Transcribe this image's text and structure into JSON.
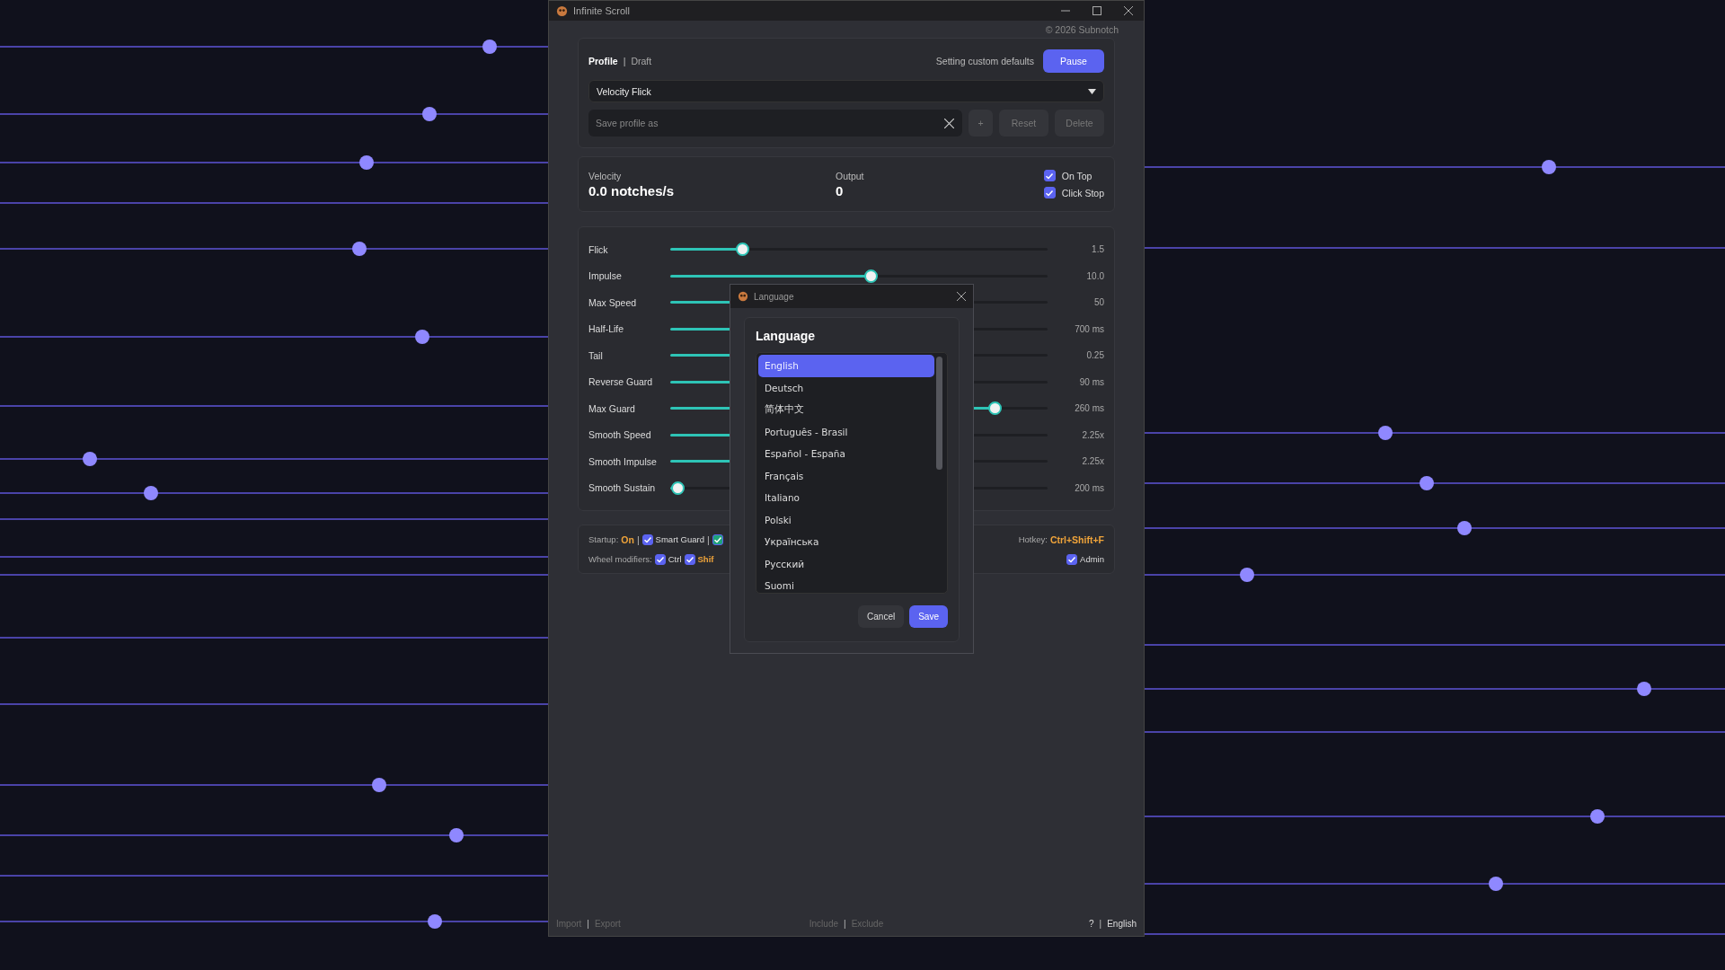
{
  "window": {
    "title": "Infinite Scroll"
  },
  "copyright": "© 2026 Subnotch",
  "profile": {
    "tabs": [
      {
        "label": "Profile",
        "selected": true
      },
      {
        "label": "Draft",
        "selected": false
      }
    ],
    "separator": "|",
    "status": "Setting custom defaults",
    "pause_button": "Pause",
    "dropdown": {
      "value": "Velocity Flick"
    },
    "save_field": {
      "placeholder": "Save profile as"
    },
    "buttons": [
      {
        "label": "+",
        "disabled": true
      },
      {
        "label": "Reset",
        "disabled": true
      },
      {
        "label": "Delete",
        "disabled": true
      }
    ]
  },
  "stats": {
    "readouts": [
      {
        "label": "Velocity",
        "value": "0.0 notches/s"
      },
      {
        "label": "Output",
        "value": "0"
      }
    ],
    "options": [
      {
        "label": "On Top",
        "checked": true
      },
      {
        "label": "Click Stop",
        "checked": true
      }
    ]
  },
  "sliders": [
    {
      "name": "Flick",
      "level": 0.19,
      "reading": "1.5"
    },
    {
      "name": "Impulse",
      "level": 0.53,
      "reading": "10.0"
    },
    {
      "name": "Max Speed",
      "level": 0.45,
      "reading": "50"
    },
    {
      "name": "Half-Life",
      "level": 0.45,
      "reading": "700 ms"
    },
    {
      "name": "Tail",
      "level": 0.45,
      "reading": "0.25"
    },
    {
      "name": "Reverse Guard",
      "level": 0.45,
      "reading": "90 ms"
    },
    {
      "name": "Max Guard",
      "level": 0.86,
      "reading": "260 ms"
    },
    {
      "name": "Smooth Speed",
      "level": 0.45,
      "reading": "2.25x"
    },
    {
      "name": "Smooth Impulse",
      "level": 0.45,
      "reading": "2.25x"
    },
    {
      "name": "Smooth Sustain",
      "level": 0.02,
      "reading": "200 ms"
    }
  ],
  "settings": {
    "startup": {
      "label": "Startup:",
      "value": "On",
      "separator": "|",
      "items": [
        {
          "label": "Smart Guard",
          "checked": true,
          "color": "#5b63f0"
        },
        {
          "checked": true,
          "color": "#1fa37a"
        }
      ]
    },
    "hotkey": {
      "label": "Hotkey:",
      "value": "Ctrl+Shift+F"
    },
    "wheel_modifiers": {
      "label": "Wheel modifiers:",
      "items": [
        {
          "label": "Ctrl",
          "checked": true,
          "highlighted": false
        },
        {
          "label": "Shif",
          "checked": true,
          "highlighted": true
        }
      ]
    },
    "admin": {
      "label": "Admin",
      "checked": true
    }
  },
  "footer": {
    "separator": "|",
    "left": [
      {
        "label": "Import",
        "disabled": true
      },
      {
        "label": "Export",
        "disabled": true
      }
    ],
    "center": [
      {
        "label": "Include",
        "disabled": true
      },
      {
        "label": "Exclude",
        "disabled": true
      }
    ],
    "right": [
      {
        "label": "?",
        "disabled": false
      },
      {
        "label": "English",
        "disabled": false
      }
    ]
  },
  "dialog": {
    "title": "Language",
    "heading": "Language",
    "languages": [
      {
        "label": "English",
        "selected": true
      },
      {
        "label": "Deutsch",
        "selected": false
      },
      {
        "label": "简体中文",
        "selected": false
      },
      {
        "label": "Português - Brasil",
        "selected": false
      },
      {
        "label": "Español - España",
        "selected": false
      },
      {
        "label": "Français",
        "selected": false
      },
      {
        "label": "Italiano",
        "selected": false
      },
      {
        "label": "Polski",
        "selected": false
      },
      {
        "label": "Українська",
        "selected": false
      },
      {
        "label": "Русский",
        "selected": false
      },
      {
        "label": "Suomi",
        "selected": false
      }
    ],
    "buttons": [
      {
        "label": "Cancel",
        "kind": "secondary"
      },
      {
        "label": "Save",
        "kind": "primary"
      }
    ]
  }
}
